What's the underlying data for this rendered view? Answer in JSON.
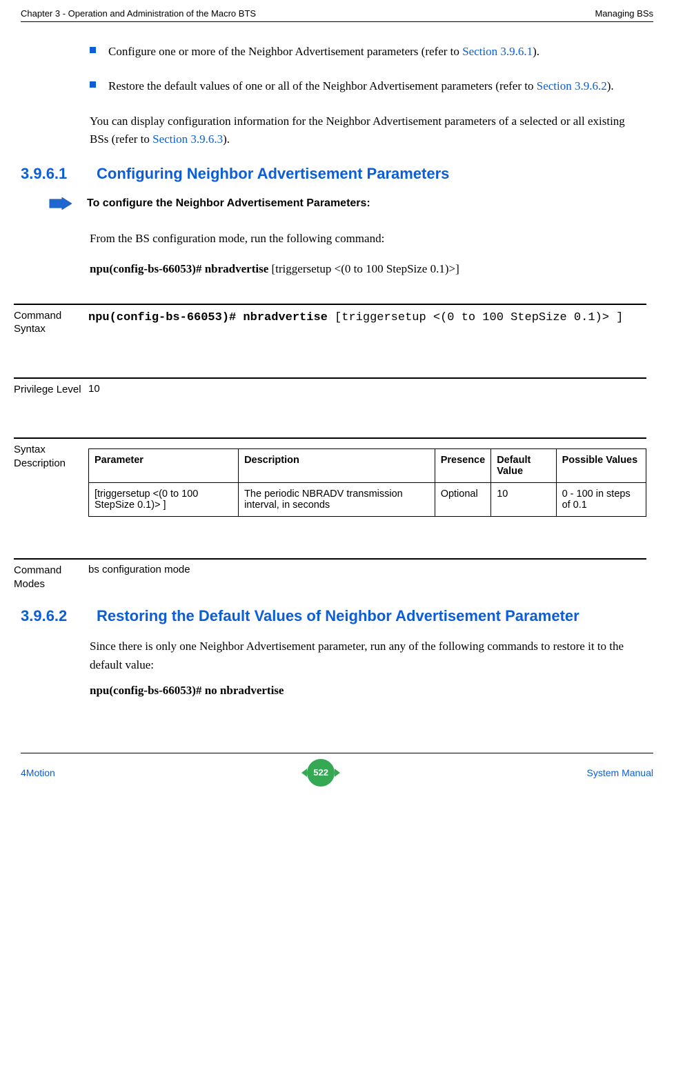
{
  "header": {
    "left": "Chapter 3 - Operation and Administration of the Macro BTS",
    "right": "Managing BSs"
  },
  "intro": {
    "bullet1_pre": "Configure one or more of the Neighbor Advertisement parameters (refer to ",
    "bullet1_link": "Section 3.9.6.1",
    "bullet1_post": ").",
    "bullet2_pre": "Restore the default values of one or all of the Neighbor Advertisement parameters (refer to ",
    "bullet2_link": "Section 3.9.6.2",
    "bullet2_post": ").",
    "para_pre": "You can display configuration information for the Neighbor Advertisement parameters of a selected or all existing BSs (refer to ",
    "para_link": "Section 3.9.6.3",
    "para_post": ")."
  },
  "s3961": {
    "num": "3.9.6.1",
    "title": "Configuring Neighbor Advertisement Parameters",
    "arrow_label": "To configure the Neighbor Advertisement Parameters:",
    "body": "From the BS configuration mode, run the following command:",
    "cmd_bold": "npu(config-bs-66053)# nbradvertise",
    "cmd_rest": " [triggersetup <(0 to 100 StepSize 0.1)>]"
  },
  "defs": {
    "syntax_label": "Command Syntax",
    "syntax_bold": "npu(config-bs-66053)# nbradvertise",
    "syntax_rest": " [triggersetup <(0 to 100 StepSize 0.1)> ]",
    "priv_label": "Privilege Level",
    "priv_value": "10",
    "syntaxdesc_label": "Syntax Description",
    "table": {
      "h_param": "Parameter",
      "h_desc": "Description",
      "h_pres": "Presence",
      "h_def": "Default Value",
      "h_poss": "Possible Values",
      "r1_param": "[triggersetup <(0 to 100 StepSize 0.1)> ]",
      "r1_desc": "The periodic NBRADV transmission interval, in seconds",
      "r1_pres": "Optional",
      "r1_def": "10",
      "r1_poss": "0 - 100 in steps of 0.1"
    },
    "modes_label": "Command Modes",
    "modes_value": "bs configuration mode"
  },
  "s3962": {
    "num": "3.9.6.2",
    "title": "Restoring the Default Values of Neighbor Advertisement Parameter",
    "body": "Since there is only one Neighbor Advertisement parameter, run any of the following commands to restore it to the default value:",
    "cmd": "npu(config-bs-66053)# no nbradvertise"
  },
  "footer": {
    "left": "4Motion",
    "page": "522",
    "right": "System Manual"
  }
}
